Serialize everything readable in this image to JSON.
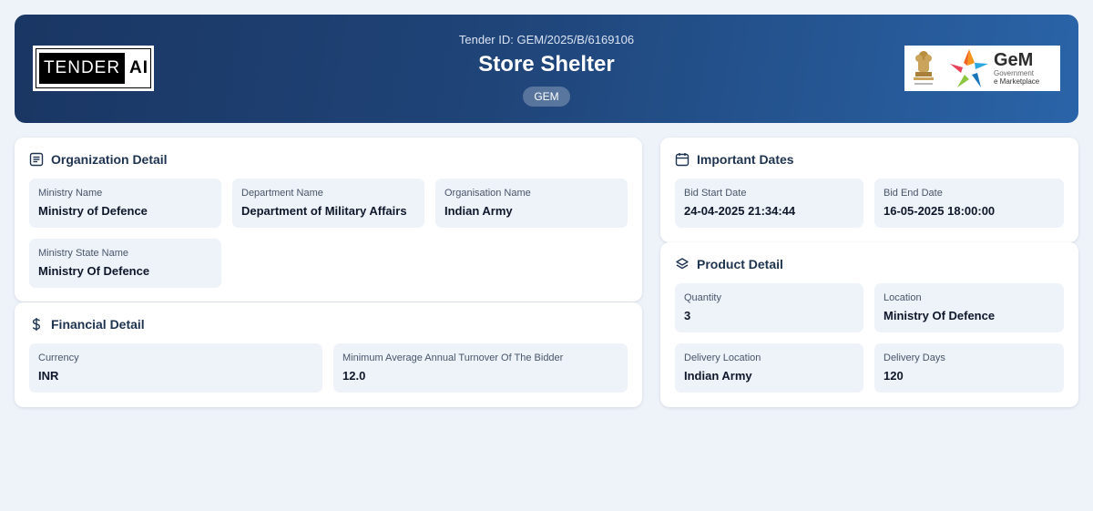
{
  "header": {
    "tender_id": "Tender ID: GEM/2025/B/6169106",
    "title": "Store Shelter",
    "badge": "GEM",
    "logo_left": {
      "part1": "TENDER",
      "part2": "AI"
    },
    "logo_right": {
      "word": "GeM",
      "line1": "Government",
      "line2": "e Marketplace"
    }
  },
  "organization": {
    "title": "Organization Detail",
    "icon": "document-list-icon",
    "fields": [
      {
        "label": "Ministry Name",
        "value": "Ministry of Defence"
      },
      {
        "label": "Department Name",
        "value": "Department of Military Affairs"
      },
      {
        "label": "Organisation Name",
        "value": "Indian Army"
      },
      {
        "label": "Ministry State Name",
        "value": "Ministry Of Defence"
      }
    ]
  },
  "financial": {
    "title": "Financial Detail",
    "icon": "dollar-icon",
    "fields": [
      {
        "label": "Currency",
        "value": "INR"
      },
      {
        "label": "Minimum Average Annual Turnover Of The Bidder",
        "value": "12.0"
      }
    ]
  },
  "dates": {
    "title": "Important Dates",
    "icon": "calendar-icon",
    "fields": [
      {
        "label": "Bid Start Date",
        "value": "24-04-2025 21:34:44"
      },
      {
        "label": "Bid End Date",
        "value": "16-05-2025 18:00:00"
      }
    ]
  },
  "product": {
    "title": "Product Detail",
    "icon": "layers-icon",
    "fields": [
      {
        "label": "Quantity",
        "value": "3"
      },
      {
        "label": "Location",
        "value": "Ministry Of Defence"
      },
      {
        "label": "Delivery Location",
        "value": "Indian Army"
      },
      {
        "label": "Delivery Days",
        "value": "120"
      }
    ]
  },
  "colors": {
    "header_gradient_start": "#1a3663",
    "header_gradient_end": "#2a64a8",
    "background": "#eef2f9",
    "field_background": "#eef2f9"
  }
}
